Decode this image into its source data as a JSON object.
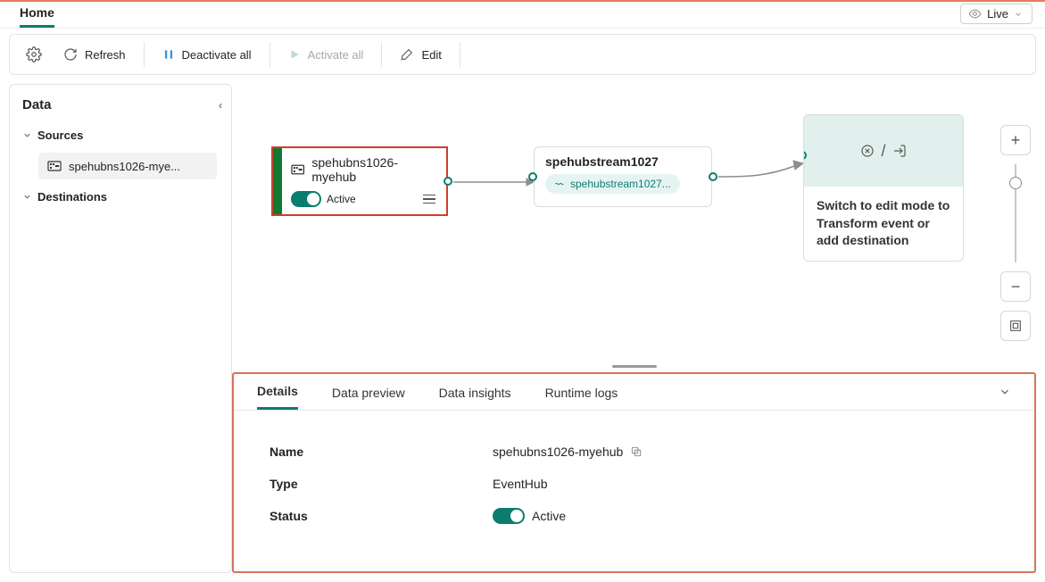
{
  "rail": {
    "home_tab": "Home",
    "live_label": "Live"
  },
  "toolbar": {
    "refresh": "Refresh",
    "deactivate_all": "Deactivate all",
    "activate_all": "Activate all",
    "edit": "Edit"
  },
  "side": {
    "title": "Data",
    "groups": {
      "sources": {
        "label": "Sources",
        "items": [
          "spehubns1026-mye..."
        ]
      },
      "destinations": {
        "label": "Destinations"
      }
    }
  },
  "canvas": {
    "source": {
      "title": "spehubns1026-myehub",
      "status": "Active"
    },
    "stream": {
      "title": "spehubstream1027",
      "pill": "spehubstream1027..."
    },
    "destination": {
      "hint": "Switch to edit mode to Transform event or add destination"
    }
  },
  "inspector": {
    "tabs": {
      "details": "Details",
      "preview": "Data preview",
      "insights": "Data insights",
      "runtime": "Runtime logs"
    },
    "details": {
      "name_label": "Name",
      "name_value": "spehubns1026-myehub",
      "type_label": "Type",
      "type_value": "EventHub",
      "status_label": "Status",
      "status_value": "Active"
    }
  }
}
